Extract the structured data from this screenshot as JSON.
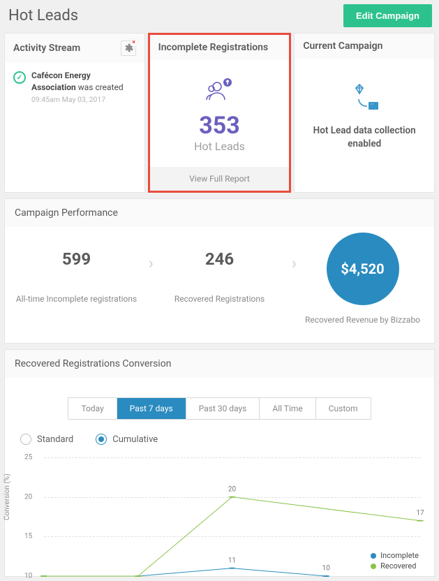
{
  "header": {
    "title": "Hot Leads",
    "edit_button": "Edit Campaign"
  },
  "activity": {
    "title": "Activity Stream",
    "items": [
      {
        "text_bold": "Cafécon Energy Association",
        "text_rest": " was created",
        "timestamp": "09:45am May 03, 2017"
      }
    ]
  },
  "incomplete": {
    "title": "Incomplete Registrations",
    "count": "353",
    "label": "Hot Leads",
    "view_report": "View Full Report"
  },
  "current": {
    "title": "Current Campaign",
    "text": "Hot Lead data collection enabled"
  },
  "performance": {
    "title": "Campaign Performance",
    "cols": [
      {
        "value": "599",
        "label": "All-time Incomplete registrations"
      },
      {
        "value": "246",
        "label": "Recovered Registrations"
      },
      {
        "value": "$4,520",
        "label": "Recovered Revenue by Bizzabo"
      }
    ]
  },
  "conversion": {
    "title": "Recovered Registrations Conversion",
    "tabs": [
      "Today",
      "Past 7 days",
      "Past 30 days",
      "All Time",
      "Custom"
    ],
    "active_tab": "Past 7 days",
    "modes": [
      "Standard",
      "Cumulative"
    ],
    "active_mode": "Cumulative",
    "legend": [
      {
        "name": "Incomplete",
        "color": "#2a8bc0"
      },
      {
        "name": "Recovered",
        "color": "#8bc34a"
      }
    ],
    "y_label": "Conversion (%)"
  },
  "chart_data": {
    "type": "line",
    "x": [
      0,
      1,
      2,
      3,
      4
    ],
    "ylim": [
      10,
      25
    ],
    "yticks": [
      10,
      15,
      20,
      25
    ],
    "ylabel": "Conversion (%)",
    "series": [
      {
        "name": "Incomplete",
        "color": "#2a8bc0",
        "values": [
          10,
          10,
          11,
          10,
          null
        ],
        "labels": {
          "2": "11",
          "3": "10"
        }
      },
      {
        "name": "Recovered",
        "color": "#8bc34a",
        "values": [
          10,
          10,
          20,
          null,
          17
        ],
        "labels": {
          "2": "20",
          "4": "17"
        }
      }
    ]
  }
}
